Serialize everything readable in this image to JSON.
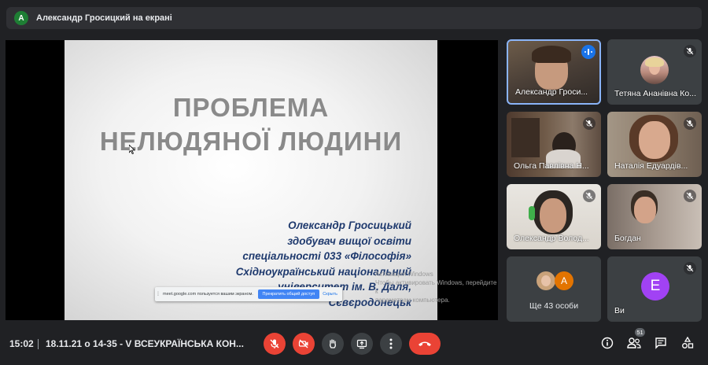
{
  "presenter_bar": {
    "avatar_letter": "А",
    "text": "Александр Гросицкий на екрані"
  },
  "slide": {
    "title_line1": "ПРОБЛЕМА",
    "title_line2": "НЕЛЮДЯНОЇ ЛЮДИНИ",
    "author_lines": [
      "Олександр Гросицький",
      "здобувач вищої освіти",
      "спеціальності 033 «Філософія»",
      "Східноукраїнський національний",
      "університет ім. В. Даля,",
      "Сєвєродонецьк"
    ],
    "activate_windows": [
      "Активация Windows",
      "Чтобы активировать Windows, перейдите к",
      "параметрам компьютера."
    ]
  },
  "share_bar": {
    "message": "meet.google.com пользуется вашим экраном.",
    "stop_label": "Прекратить общий доступ",
    "hide_label": "Скрыть"
  },
  "participants": [
    {
      "name": "Александр Гроси...",
      "state": "speaking"
    },
    {
      "name": "Тетяна Ананівна Ко...",
      "state": "muted"
    },
    {
      "name": "Ольга Павлівна Н...",
      "state": "muted"
    },
    {
      "name": "Наталія Едуардів...",
      "state": "muted"
    },
    {
      "name": "Олександр Волод...",
      "state": "muted"
    },
    {
      "name": "Богдан",
      "state": "muted"
    },
    {
      "name": "Ще 43 особи",
      "state": "muted",
      "avatar_letter": "А"
    },
    {
      "name": "Ви",
      "state": "muted",
      "avatar_letter": "E"
    }
  ],
  "bottom": {
    "time": "15:02",
    "meeting_title": "18.11.21 о 14-35 - V ВСЕУКРАЇНСЬКА КОН...",
    "participants_count": "51"
  },
  "colors": {
    "background": "#202124",
    "tile": "#3c4043",
    "danger": "#ea4335",
    "accent": "#8ab4f8",
    "slide_text": "#1f3a6e"
  }
}
